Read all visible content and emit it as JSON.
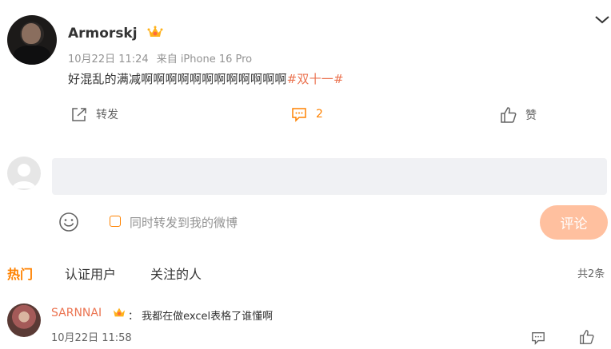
{
  "post": {
    "username": "Armorskj",
    "date": "10月22日 11:24",
    "source": "来自 iPhone 16 Pro",
    "text": "好混乱的满减啊啊啊啊啊啊啊啊啊啊啊啊",
    "hashtag": "#双十一#",
    "actions": {
      "repost_label": "转发",
      "comment_count": "2",
      "like_label": "赞"
    }
  },
  "composer": {
    "placeholder": "",
    "repost_option_label": "同时转发到我的微博",
    "submit_label": "评论"
  },
  "tabs": {
    "hot": "热门",
    "verified": "认证用户",
    "following": "关注的人",
    "total": "共2条"
  },
  "comments": [
    {
      "username": "SARNNAI",
      "text": "：  我都在做excel表格了谁懂啊",
      "time": "10月22日 11:58"
    }
  ],
  "colors": {
    "accent": "#ff8200",
    "link": "#eb7350",
    "submit_disabled": "#ffc09f"
  }
}
